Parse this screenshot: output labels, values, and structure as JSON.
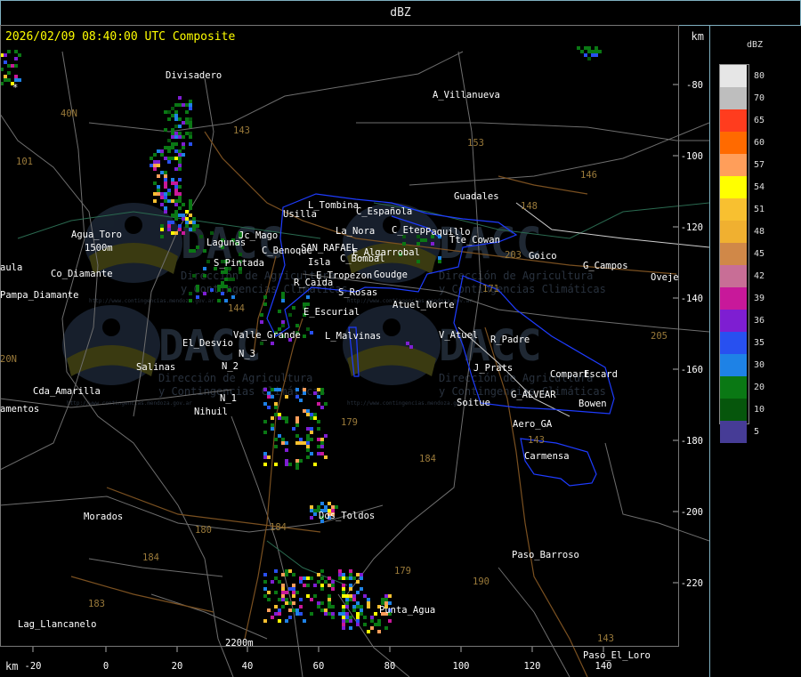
{
  "header": {
    "title": "dBZ"
  },
  "map": {
    "timestamp": "2026/02/09 08:40:00 UTC Composite",
    "km_top": "km",
    "km_bottom": "km",
    "x_ticks": [
      "-20",
      "0",
      "20",
      "40",
      "60",
      "80",
      "100",
      "120",
      "140"
    ],
    "y_ticks": [
      "-80",
      "-100",
      "-120",
      "-140",
      "-160",
      "-180",
      "-200",
      "-220"
    ],
    "places": [
      "Divisadero",
      "A_Villanueva",
      "40N",
      "101",
      "143",
      "153",
      "146",
      "148",
      "Guadales",
      "L_Tombina",
      "Usilla",
      "C_Española",
      "La_Nora",
      "C_Etep",
      "Paquillo",
      "Tte_Cowan",
      "203",
      "Goico",
      "G_Campos",
      "Oveje",
      "Agua_Toro",
      "1500m",
      "Co_Diamante",
      "aula",
      "Pampa_Diamante",
      "Lagunas",
      "Jc_Mago",
      "C_Benoque",
      "SAN_RAFAEL",
      "E_Algarrobal",
      "S_Pintada",
      "Isla",
      "C_Bombal",
      "E_Tropezon",
      "Goudge",
      "R_Caida",
      "S_Rosas",
      "171",
      "Atuel_Norte",
      "E_Escurial",
      "144",
      "El_Desvio",
      "Valle_Grande",
      "L_Malvinas",
      "V_Atuel",
      "R_Padre",
      "205",
      "Salinas",
      "N_3",
      "N_2",
      "J_Prats",
      "Compart",
      "Escard",
      "Cda_Amarilla",
      "N_1",
      "Nihuil",
      "G_ALVEAR",
      "Bowen",
      "Soitue",
      "amentos",
      "Aero_GA",
      "143",
      "179",
      "Carmensa",
      "184",
      "Morados",
      "180",
      "Dos_Toldos",
      "184",
      "179",
      "190",
      "Paso_Barroso",
      "184",
      "183",
      "Lag_Llancanelo",
      "Punta_Agua",
      "2200m",
      "143",
      "Paso_El_Loro",
      "20N",
      "*"
    ],
    "watermark": {
      "logo": "DACC",
      "line1": "Dirección de Agricultura",
      "line2": "y Contingencias Climáticas",
      "url": "http://www.contingencias.mendoza.gov.ar"
    }
  },
  "legend": {
    "title": "dBZ",
    "levels": [
      {
        "label": "80",
        "color": "#e6e6e6"
      },
      {
        "label": "70",
        "color": "#bebebe"
      },
      {
        "label": "65",
        "color": "#ff3c1e"
      },
      {
        "label": "60",
        "color": "#ff6a00"
      },
      {
        "label": "57",
        "color": "#ff9e5a"
      },
      {
        "label": "54",
        "color": "#ffff00"
      },
      {
        "label": "51",
        "color": "#f8c030"
      },
      {
        "label": "48",
        "color": "#f0b030"
      },
      {
        "label": "45",
        "color": "#d08848"
      },
      {
        "label": "42",
        "color": "#c86e96"
      },
      {
        "label": "39",
        "color": "#c8189a"
      },
      {
        "label": "36",
        "color": "#7e1ed2"
      },
      {
        "label": "35",
        "color": "#2850f0"
      },
      {
        "label": "30",
        "color": "#1e82e6"
      },
      {
        "label": "20",
        "color": "#0a7814"
      },
      {
        "label": "10",
        "color": "#06560c"
      },
      {
        "label": "5",
        "color": "#463c96"
      }
    ]
  }
}
